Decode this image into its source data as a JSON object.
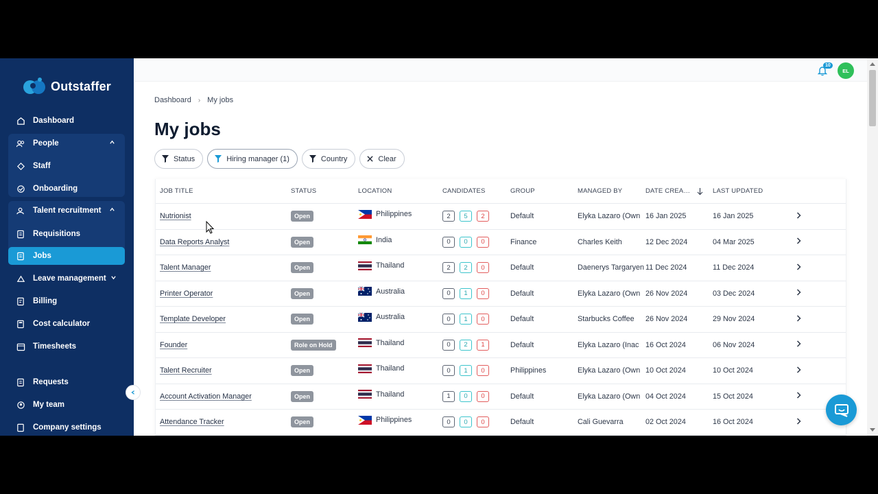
{
  "app": {
    "brand": "Outstaffer"
  },
  "colors": {
    "sidebar": "#0e2f63",
    "accent": "#1a9ad6",
    "avatar": "#2fc05a"
  },
  "sidebar": {
    "items": [
      {
        "label": "Dashboard",
        "icon": "home-icon"
      },
      {
        "label": "People",
        "icon": "people-icon"
      },
      {
        "label": "Staff",
        "icon": "staff-icon"
      },
      {
        "label": "Onboarding",
        "icon": "onboarding-icon"
      },
      {
        "label": "Talent recruitment",
        "icon": "talent-icon"
      },
      {
        "label": "Requisitions",
        "icon": "requisitions-icon"
      },
      {
        "label": "Jobs",
        "icon": "jobs-icon"
      },
      {
        "label": "Leave management",
        "icon": "leave-icon"
      },
      {
        "label": "Billing",
        "icon": "billing-icon"
      },
      {
        "label": "Cost calculator",
        "icon": "calculator-icon"
      },
      {
        "label": "Timesheets",
        "icon": "timesheets-icon"
      },
      {
        "label": "Requests",
        "icon": "requests-icon"
      },
      {
        "label": "My team",
        "icon": "team-icon"
      },
      {
        "label": "Company settings",
        "icon": "settings-icon"
      }
    ]
  },
  "topbar": {
    "notification_count": "10",
    "avatar_initials": "EL"
  },
  "breadcrumb": {
    "root": "Dashboard",
    "current": "My jobs"
  },
  "page": {
    "title": "My jobs"
  },
  "filters": {
    "status": "Status",
    "hiring_manager": "Hiring manager (1)",
    "country": "Country",
    "clear": "Clear"
  },
  "table": {
    "headers": {
      "title": "JOB TITLE",
      "status": "STATUS",
      "location": "LOCATION",
      "candidates": "CANDIDATES",
      "group": "GROUP",
      "managed_by": "MANAGED BY",
      "date_created": "DATE CREA…",
      "last_updated": "LAST UPDATED"
    },
    "rows": [
      {
        "title": "Nutrionist",
        "status": "Open",
        "location": "Philippines",
        "flag": "ph",
        "c1": "2",
        "c2": "5",
        "c3": "2",
        "group": "Default",
        "manager": "Elyka Lazaro (Own",
        "created": "16 Jan 2025",
        "updated": "16 Jan 2025"
      },
      {
        "title": "Data Reports Analyst",
        "status": "Open",
        "location": "India",
        "flag": "in",
        "c1": "0",
        "c2": "0",
        "c3": "0",
        "group": "Finance",
        "manager": "Charles Keith",
        "created": "12 Dec 2024",
        "updated": "04 Mar 2025"
      },
      {
        "title": "Talent Manager",
        "status": "Open",
        "location": "Thailand",
        "flag": "th",
        "c1": "2",
        "c2": "2",
        "c3": "0",
        "group": "Default",
        "manager": "Daenerys Targaryen",
        "created": "11 Dec 2024",
        "updated": "11 Dec 2024"
      },
      {
        "title": "Printer Operator",
        "status": "Open",
        "location": "Australia",
        "flag": "au",
        "c1": "0",
        "c2": "1",
        "c3": "0",
        "group": "Default",
        "manager": "Elyka Lazaro (Own",
        "created": "26 Nov 2024",
        "updated": "03 Dec 2024"
      },
      {
        "title": "Template Developer",
        "status": "Open",
        "location": "Australia",
        "flag": "au",
        "c1": "0",
        "c2": "1",
        "c3": "0",
        "group": "Default",
        "manager": "Starbucks Coffee",
        "created": "26 Nov 2024",
        "updated": "29 Nov 2024"
      },
      {
        "title": "Founder",
        "status": "Role on Hold",
        "location": "Thailand",
        "flag": "th",
        "c1": "0",
        "c2": "2",
        "c3": "1",
        "group": "Default",
        "manager": "Elyka Lazaro (Inac",
        "created": "16 Oct 2024",
        "updated": "06 Nov 2024"
      },
      {
        "title": "Talent Recruiter",
        "status": "Open",
        "location": "Thailand",
        "flag": "th",
        "c1": "0",
        "c2": "1",
        "c3": "0",
        "group": "Philippines",
        "manager": "Elyka Lazaro (Own",
        "created": "10 Oct 2024",
        "updated": "10 Oct 2024"
      },
      {
        "title": "Account Activation Manager",
        "status": "Open",
        "location": "Thailand",
        "flag": "th",
        "c1": "1",
        "c2": "0",
        "c3": "0",
        "group": "Default",
        "manager": "Elyka Lazaro (Own",
        "created": "04 Oct 2024",
        "updated": "15 Oct 2024"
      },
      {
        "title": "Attendance Tracker",
        "status": "Open",
        "location": "Philippines",
        "flag": "ph",
        "c1": "0",
        "c2": "0",
        "c3": "0",
        "group": "Default",
        "manager": "Cali Guevarra",
        "created": "02 Oct 2024",
        "updated": "16 Oct 2024"
      }
    ]
  }
}
